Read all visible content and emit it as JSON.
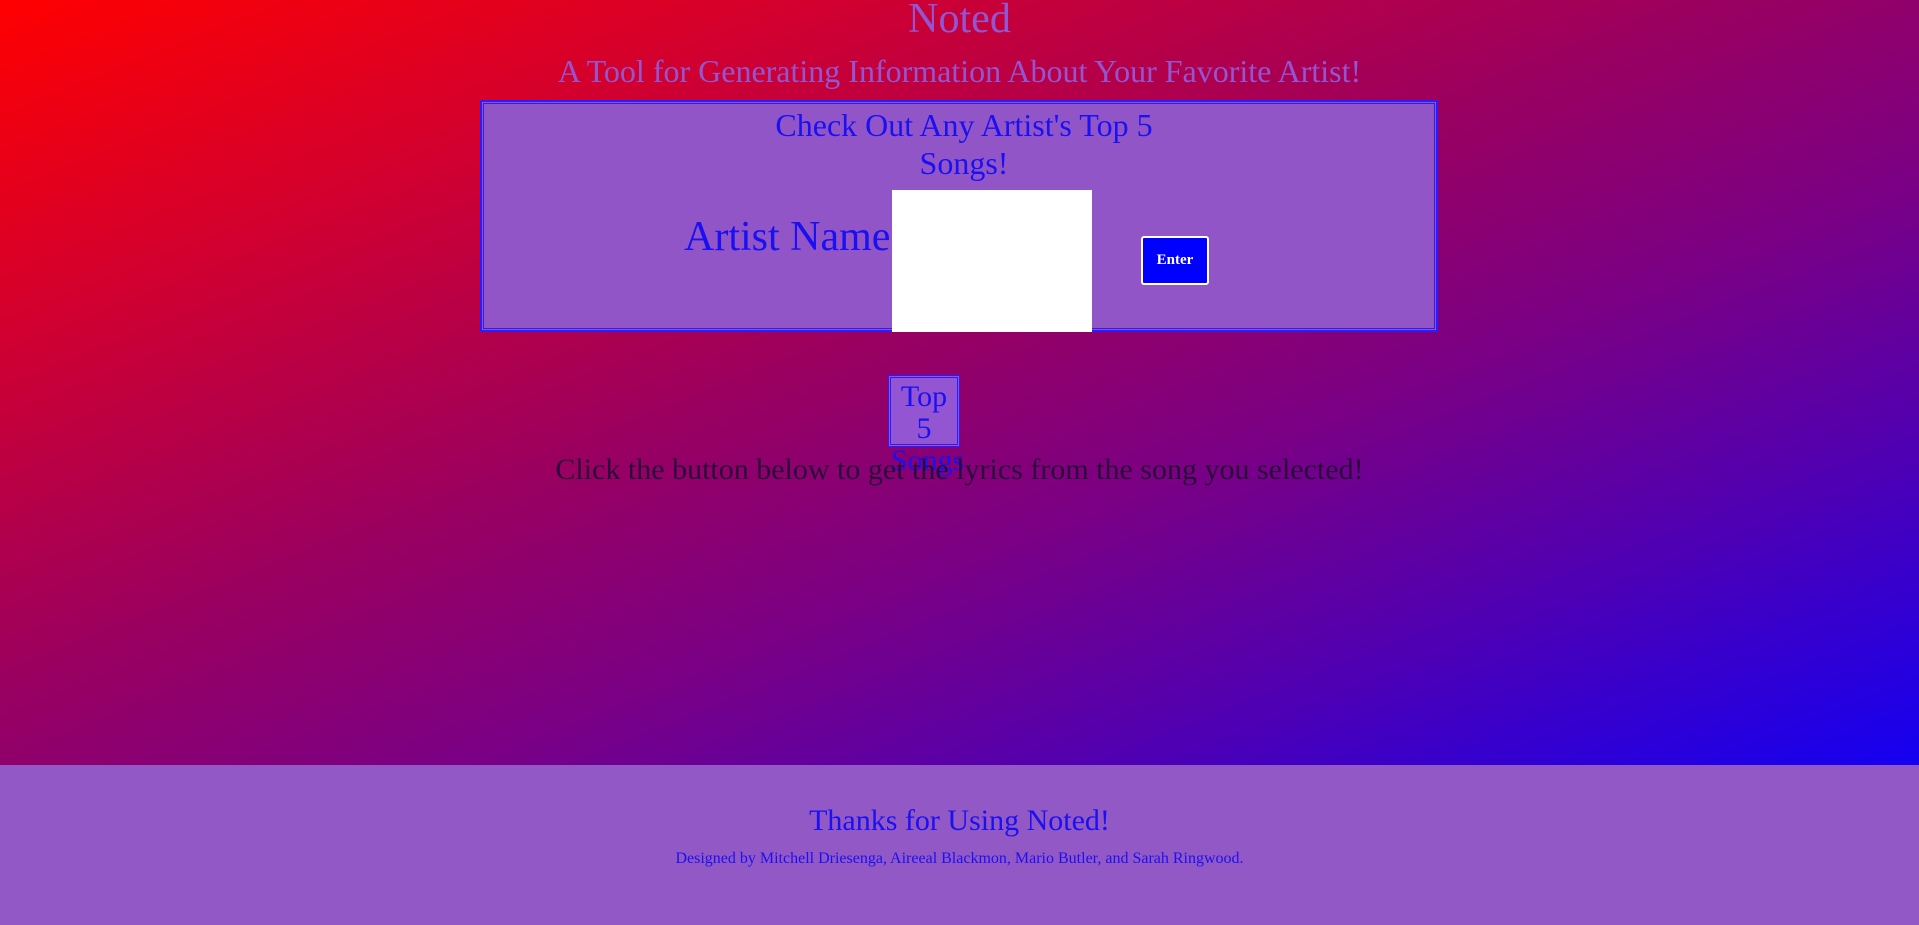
{
  "header": {
    "title": "Noted",
    "subtitle": "A Tool for Generating Information About Your Favorite Artist!"
  },
  "search_panel": {
    "heading": "Check Out Any Artist's Top 5 Songs!",
    "artist_label": "Artist Name",
    "artist_input_value": "",
    "enter_button_label": "Enter"
  },
  "results": {
    "top5_label": "Top 5 Songs",
    "instructions": "Click the button below to get the lyrics from the song you selected!"
  },
  "footer": {
    "thanks": "Thanks for Using Noted!",
    "credits": "Designed by Mitchell Driesenga, Aireeal Blackmon, Mario Butler, and Sarah Ringwood."
  },
  "colors": {
    "accent_purple": "#9455d2",
    "text_blue": "#1a10f0",
    "button_blue": "#0000ff"
  }
}
